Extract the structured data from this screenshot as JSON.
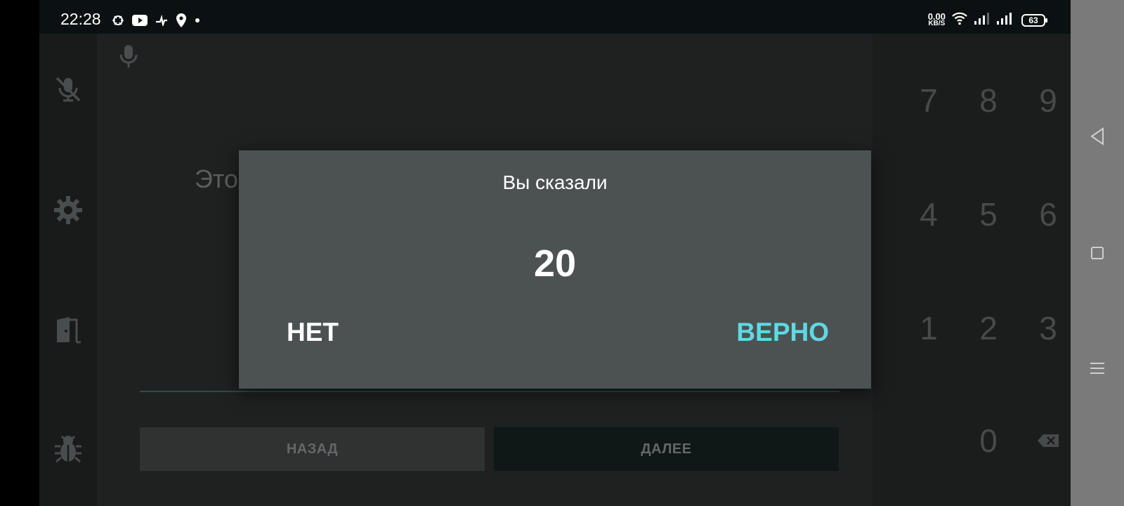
{
  "status_bar": {
    "time": "22:28",
    "icons": [
      "bug-status-icon",
      "youtube-icon",
      "download-status-icon",
      "location-icon",
      "dot-icon"
    ],
    "net_speed_value": "0.00",
    "net_speed_unit": "KB/S",
    "right_icons": [
      "wifi-icon",
      "signal-icon",
      "signal-icon"
    ],
    "battery": "63"
  },
  "side_rail": {
    "items": [
      "mic-off-icon",
      "gear-icon",
      "exit-door-icon",
      "bug-icon"
    ]
  },
  "main": {
    "prompt_partial": "Это",
    "back_label": "НАЗАД",
    "next_label": "ДАЛЕЕ"
  },
  "numpad": {
    "keys": [
      "7",
      "8",
      "9",
      "4",
      "5",
      "6",
      "1",
      "2",
      "3",
      "0"
    ],
    "backspace_icon": "backspace-icon"
  },
  "dialog": {
    "title": "Вы сказали",
    "value": "20",
    "no_label": "НЕТ",
    "yes_label": "ВЕРНО"
  },
  "system_nav": {
    "icons": [
      "back-icon",
      "home-icon",
      "menu-icon"
    ]
  },
  "colors": {
    "accent": "#5fd9e3",
    "dialog_bg": "#4c5252",
    "app_bg": "#1f2121"
  }
}
